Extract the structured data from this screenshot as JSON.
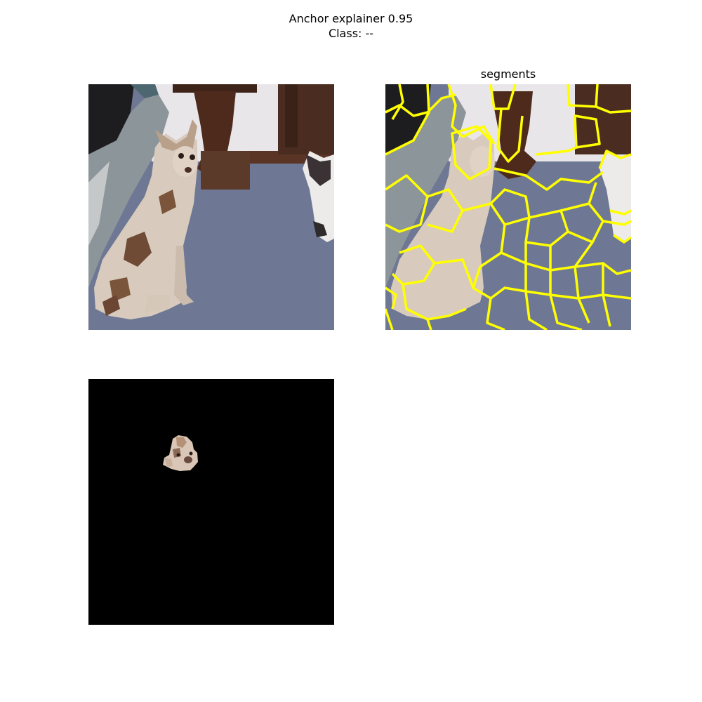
{
  "figure": {
    "title_line1": "Anchor explainer 0.95",
    "title_line2": "Class: --"
  },
  "panels": {
    "segments_title": "segments"
  },
  "colors": {
    "boundary": "#ffff00",
    "carpet": "#6e7894",
    "wall": "#e9e6ea",
    "wood": "#4d2a1c",
    "mask": "#000000"
  }
}
